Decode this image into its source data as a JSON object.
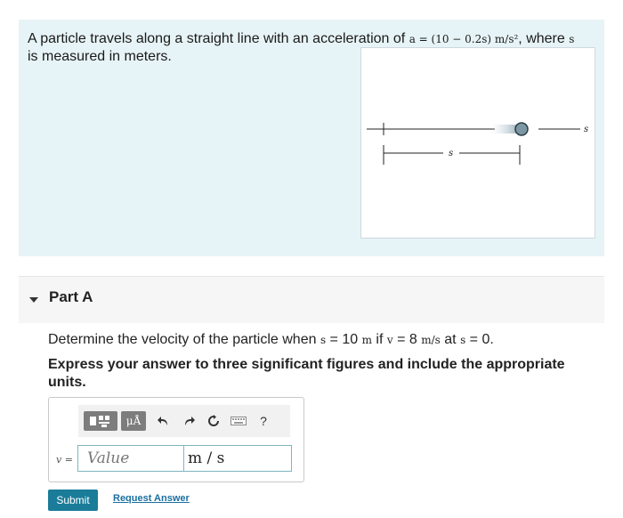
{
  "problem": {
    "text_before": "A particle travels along a straight line with an acceleration of ",
    "accel_expr": "a = (10 − 0.2s) m/s²",
    "text_middle": ", where ",
    "s_var": "s",
    "text_after": " is measured in meters.",
    "figure": {
      "label_s_axis": "s",
      "label_s_dim": "s"
    }
  },
  "partA": {
    "title": "Part A",
    "q_prefix": "Determine the velocity of the particle when ",
    "q_s": "s",
    "q_eq1": " = 10 ",
    "q_unit_m": "m",
    "q_if": " if ",
    "q_v": "v",
    "q_eq2": " = 8 ",
    "q_unit_ms": "m/s",
    "q_at": " at ",
    "q_s2": "s",
    "q_eq3": " = 0.",
    "instruction": "Express your answer to three significant figures and include the appropriate units."
  },
  "answer": {
    "variable_label": "v =",
    "value_placeholder": "Value",
    "units_value": "m / s",
    "toolbar": {
      "templates_icon": "templates-icon",
      "units_label": "μÅ",
      "undo_icon": "undo-icon",
      "redo_icon": "redo-icon",
      "reset_icon": "reset-icon",
      "keyboard_icon": "keyboard-icon",
      "help_label": "?"
    }
  },
  "actions": {
    "submit_label": "Submit",
    "request_label": "Request Answer"
  },
  "colors": {
    "problem_bg": "#e7f4f7",
    "submit_bg": "#1a7c99",
    "link": "#1a6fa0"
  }
}
